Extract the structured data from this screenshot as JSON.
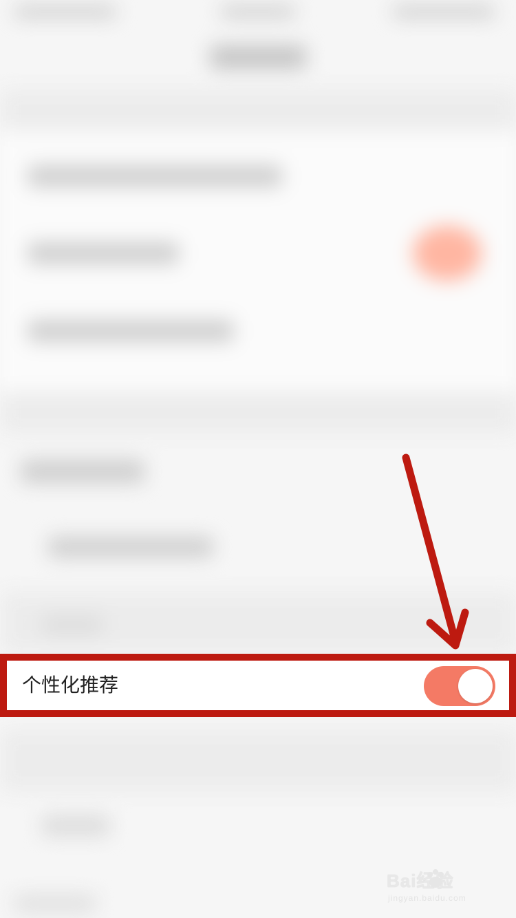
{
  "settings_row": {
    "label": "个性化推荐",
    "toggle_state": "on"
  },
  "colors": {
    "highlight_border": "#bd1a10",
    "toggle_on": "#f47a65",
    "arrow": "#bd1a10"
  },
  "watermark": {
    "main": "Bai经验",
    "sub": "jingyan.baidu.com"
  },
  "icons": [
    "arrow-annotation-icon",
    "baidu-paw-icon"
  ]
}
